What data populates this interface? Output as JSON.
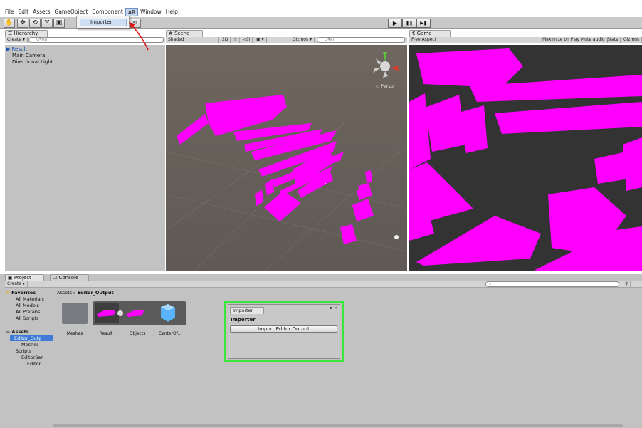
{
  "menu": [
    "File",
    "Edit",
    "Assets",
    "GameObject",
    "Component",
    "AR",
    "Window",
    "Help"
  ],
  "menu_active": "AR",
  "dropdown": {
    "items": [
      "Importer"
    ]
  },
  "toolbar": {
    "tools": [
      "✋",
      "✥",
      "⟲",
      "⤧",
      "▣"
    ],
    "partial_label": "al",
    "play": "▶",
    "pause": "❚❚",
    "step": "▶❚"
  },
  "hierarchy": {
    "tab": "☰ Hierarchy",
    "create": "Create ▾",
    "search": "Q▾All",
    "items": [
      {
        "label": "▶ Result",
        "color": "#1b57b5"
      },
      {
        "label": "Main Camera",
        "color": "#111111"
      },
      {
        "label": "Directional Light",
        "color": "#111111"
      }
    ]
  },
  "scene": {
    "tab": "# Scene",
    "shading": "Shaded",
    "mode_2d": "2D",
    "light": "☼",
    "audio": "◁))",
    "fx": "▣ ▾",
    "gizmos": "Gizmos ▾",
    "search": "Q▾All",
    "persp": "◁ Persp",
    "mesh_color": "#ff00ff"
  },
  "game": {
    "tab": "€ Game",
    "aspect": "Free Aspect",
    "options": [
      "Maximize on Play",
      "Mute audio",
      "Stats",
      "Gizmos"
    ]
  },
  "project": {
    "tabs": [
      "▣ Project",
      "☐ Console"
    ],
    "create": "Create ▾",
    "breadcrumb": [
      "Assets",
      "▸",
      "Editor_Output"
    ],
    "favorites_label": "Favorites",
    "favorites": [
      "All Materials",
      "All Models",
      "All Prefabs",
      "All Scripts"
    ],
    "assets_label": "Assets",
    "tree": [
      "Editor_Outp",
      "Meshes",
      "Scripts",
      "EditorSer",
      "Editor"
    ],
    "assets": [
      "Meshes",
      "Result",
      "Objects",
      "CenterOf..."
    ]
  },
  "importer": {
    "tab": "Importer",
    "title": "Importer",
    "button": "Import Editor Output"
  }
}
